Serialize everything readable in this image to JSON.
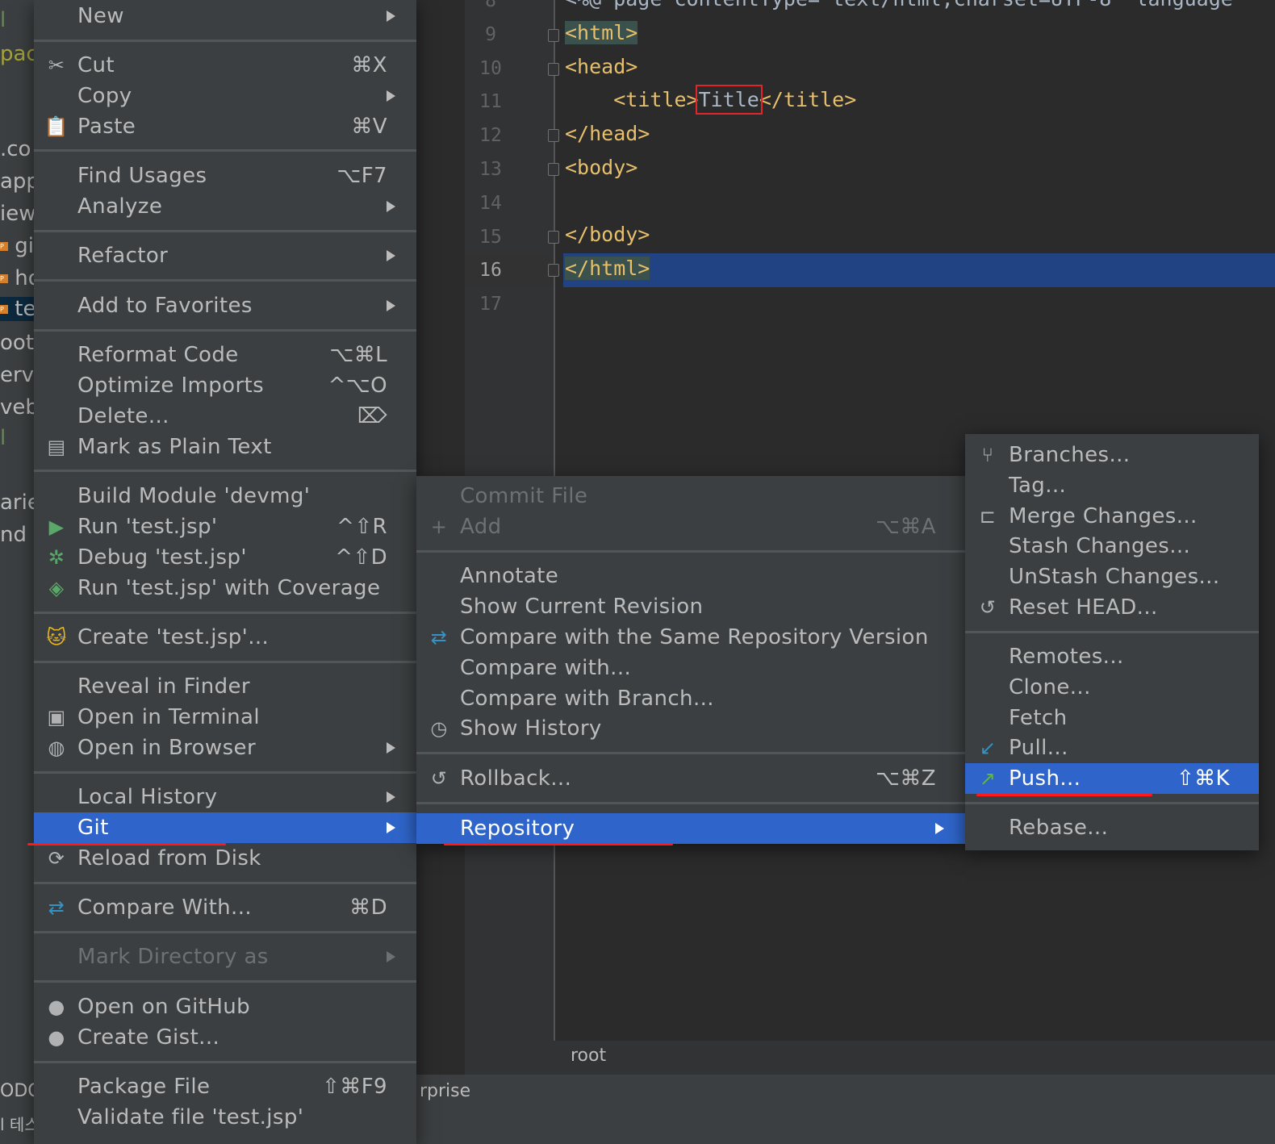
{
  "project_panel": {
    "items": [
      {
        "text": "l",
        "style": "green"
      },
      {
        "text": "pace",
        "style": "olive"
      },
      {
        "text": ".co",
        "style": ""
      },
      {
        "text": "app",
        "style": ""
      },
      {
        "text": "iew",
        "style": ""
      },
      {
        "text": "gi",
        "style": "badge"
      },
      {
        "text": "ho",
        "style": "badge"
      },
      {
        "text": "te",
        "style": "badge-selected"
      },
      {
        "text": "oot-",
        "style": ""
      },
      {
        "text": "ervi",
        "style": ""
      },
      {
        "text": "veb.",
        "style": ""
      },
      {
        "text": "l",
        "style": "green"
      },
      {
        "text": "arie",
        "style": ""
      },
      {
        "text": "nd C",
        "style": ""
      }
    ],
    "badge_letter": "P",
    "bottom_1": "ODO",
    "bottom_2": "l 테스"
  },
  "editor": {
    "partial_top_line": "<%@ page contentType=\"text/html;charset=UTF-8\" language",
    "line_numbers": [
      "8",
      "9",
      "10",
      "11",
      "12",
      "13",
      "14",
      "15",
      "16",
      "17"
    ],
    "current_line": "16",
    "lines": {
      "l9": "<html>",
      "l10": "<head>",
      "l11_open": "<title>",
      "l11_text": "Title",
      "l11_close": "</title>",
      "l12": "</head>",
      "l13": "<body>",
      "l15": "</body>",
      "l16": "</html>"
    },
    "breadcrumb": "root",
    "status_text": "rprise"
  },
  "main_menu": {
    "new": "New",
    "cut": "Cut",
    "cut_sc": "⌘X",
    "copy": "Copy",
    "paste": "Paste",
    "paste_sc": "⌘V",
    "find_usages": "Find Usages",
    "find_usages_sc": "⌥F7",
    "analyze": "Analyze",
    "refactor": "Refactor",
    "add_favorites": "Add to Favorites",
    "reformat": "Reformat Code",
    "reformat_sc": "⌥⌘L",
    "optimize": "Optimize Imports",
    "optimize_sc": "^⌥O",
    "delete": "Delete...",
    "delete_sc": "⌦",
    "mark_plain": "Mark as Plain Text",
    "build_module": "Build Module 'devmg'",
    "run": "Run 'test.jsp'",
    "run_sc": "^⇧R",
    "debug": "Debug 'test.jsp'",
    "debug_sc": "^⇧D",
    "run_coverage": "Run 'test.jsp' with Coverage",
    "create": "Create 'test.jsp'...",
    "reveal_finder": "Reveal in Finder",
    "open_terminal": "Open in Terminal",
    "open_browser": "Open in Browser",
    "local_history": "Local History",
    "git": "Git",
    "reload_disk": "Reload from Disk",
    "compare_with": "Compare With...",
    "compare_with_sc": "⌘D",
    "mark_directory": "Mark Directory as",
    "open_github": "Open on GitHub",
    "create_gist": "Create Gist...",
    "package_file": "Package File",
    "package_file_sc": "⇧⌘F9",
    "validate": "Validate file 'test.jsp'"
  },
  "git_menu": {
    "commit_file": "Commit File",
    "add": "Add",
    "add_sc": "⌥⌘A",
    "annotate": "Annotate",
    "show_current_revision": "Show Current Revision",
    "compare_same_repo": "Compare with the Same Repository Version",
    "compare_with": "Compare with...",
    "compare_branch": "Compare with Branch...",
    "show_history": "Show History",
    "rollback": "Rollback...",
    "rollback_sc": "⌥⌘Z",
    "repository": "Repository"
  },
  "repo_menu": {
    "branches": "Branches...",
    "tag": "Tag...",
    "merge": "Merge Changes...",
    "stash": "Stash Changes...",
    "unstash": "UnStash Changes...",
    "reset_head": "Reset HEAD...",
    "remotes": "Remotes...",
    "clone": "Clone...",
    "fetch": "Fetch",
    "pull": "Pull...",
    "push": "Push...",
    "push_sc": "⇧⌘K",
    "rebase": "Rebase..."
  },
  "colors": {
    "selection": "#2f65ca",
    "annotation_red": "#ff1a1a",
    "editor_bg": "#2b2b2b",
    "menu_bg": "#3c3f41"
  }
}
